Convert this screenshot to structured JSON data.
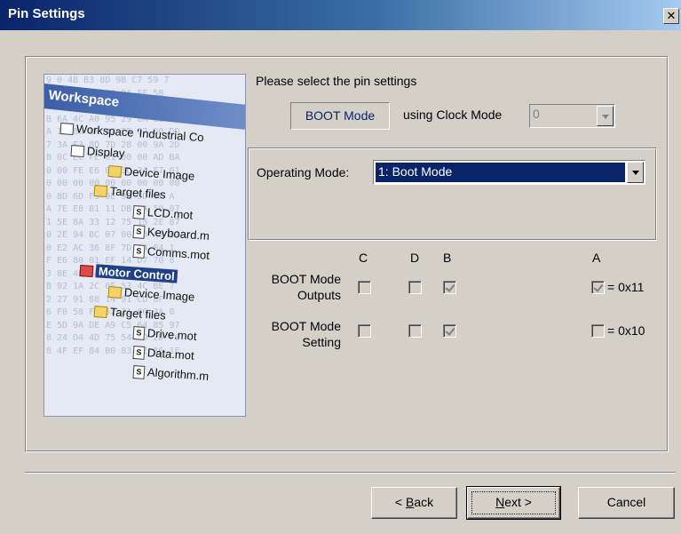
{
  "window": {
    "title": "Pin Settings",
    "close_glyph": "✕"
  },
  "workspace_image": {
    "banner": "Workspace",
    "hex_rows": [
      "9 0 4B B3 8D 9B C7 59 7",
      "8 AE 54 B1 48 DA FF 5B",
      "7 2A 9A 2F 5A 4D 5D 19 3F",
      "B 6A 4C A0 95 29 8A 63 C",
      "A 1D 8C 8F 42 E5 67 00 DD",
      "7 3A E3 8D 7D 28 00 9A 2D",
      "B 0C EC FE 01 00 00 AD BA",
      "0 00 FE E6 8F 3C 24 F7 01",
      "0 00 00 00 00 00 00 00 00",
      "0 8D 6D F9 9E 9E 5D 0F A",
      "A 7E E8 B1 11 DB CA 59 07",
      "1 5E 8A 33 12 75 15 2E 87",
      "0 2E 94 BC 07 00 93 A8 81",
      "0 E2 AC 36 8F 7D 14 84 1",
      "F E6 80 01 EF 14 D7 70 8",
      "3 8E 4B 6B 1C 84 BF 0F 0",
      "B 92 1A 2C 0F 53 4C BE 7",
      "2 27 91 08 14 91 CD 0F",
      "6 F0 58 FD 52 21 C6 3A 0",
      "E 5D 9A DE A9 C5 64 85 97",
      "8 24 D4 4D 75 54 AD 2D F6",
      "8 4F EF 84 B0 83 6E 86 1E"
    ],
    "tree": {
      "workspace": "Workspace 'Industrial Co",
      "display": "Display",
      "device_image_1": "Device Image",
      "target_files_1": "Target files",
      "file_lcd": "LCD.mot",
      "file_keyboard": "Keyboard.m",
      "file_comms": "Comms.mot",
      "motor_control": "Motor Control",
      "device_image_2": "Device Image",
      "target_files_2": "Target files",
      "file_drive": "Drive.mot",
      "file_data": "Data.mot",
      "file_algorithm": "Algorithm.m",
      "file_icon_glyph": "S"
    }
  },
  "prompt": "Please select the pin settings",
  "boot_mode_box": "BOOT Mode",
  "clock": {
    "label": "using Clock Mode",
    "value": "0"
  },
  "operating_mode": {
    "label": "Operating Mode:",
    "value": "1: Boot Mode"
  },
  "pins": {
    "headers": {
      "c": "C",
      "d": "D",
      "b": "B",
      "a": "A"
    },
    "outputs": {
      "label_1": "BOOT Mode",
      "label_2": "Outputs",
      "value": "= 0x11",
      "c": false,
      "d": false,
      "b": true,
      "a": true
    },
    "setting": {
      "label_1": "BOOT Mode",
      "label_2": "Setting",
      "value": "= 0x10",
      "c": false,
      "d": false,
      "b": true,
      "a": false
    }
  },
  "buttons": {
    "back": {
      "prefix": "< ",
      "accel": "B",
      "rest": "ack"
    },
    "next": {
      "accel": "N",
      "rest": "ext >"
    },
    "cancel": "Cancel"
  }
}
